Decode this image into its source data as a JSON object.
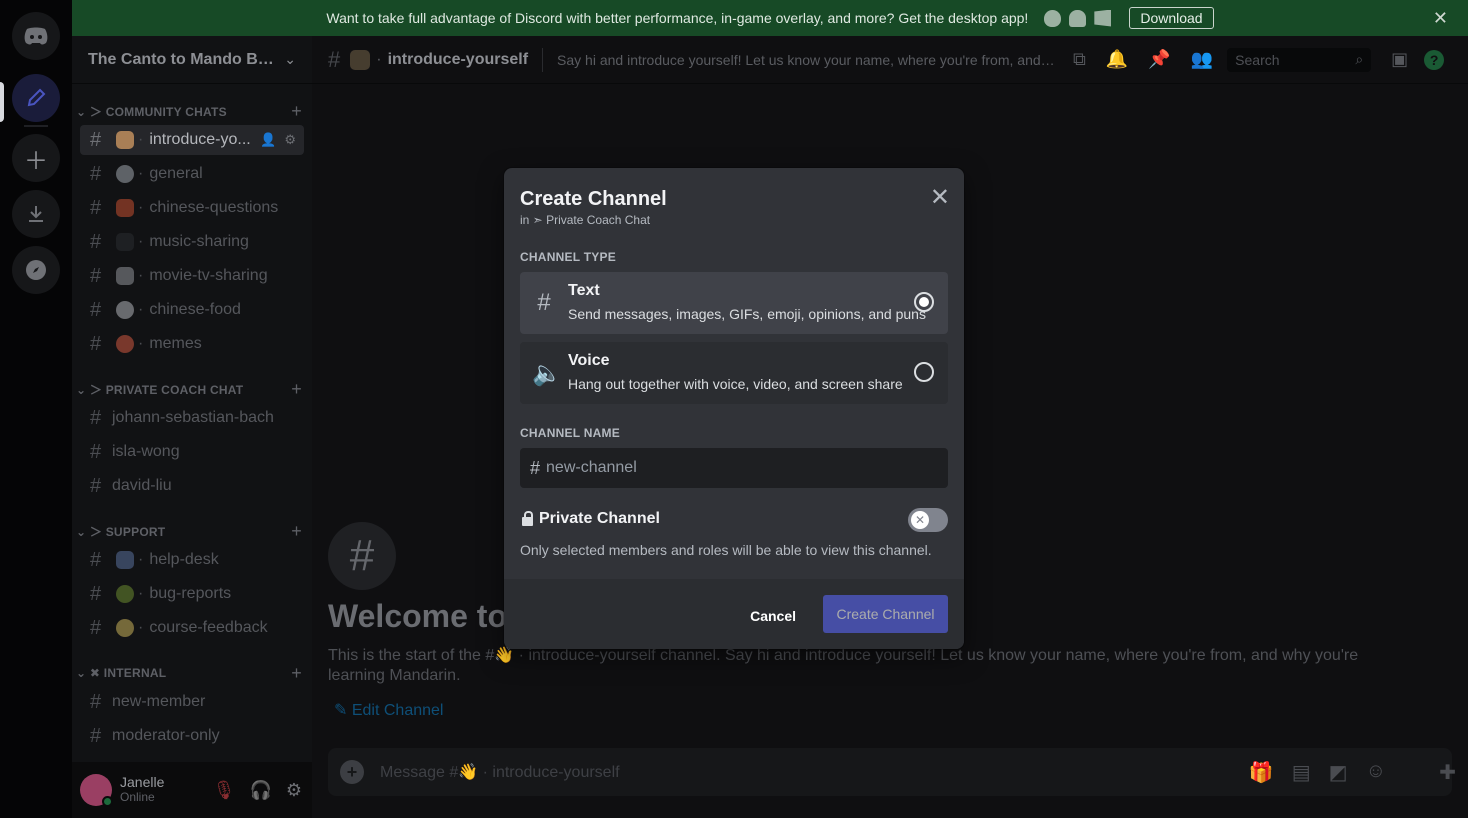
{
  "banner": {
    "text": "Want to take full advantage of Discord with better performance, in-game overlay, and more? Get the desktop app!",
    "download_label": "Download",
    "close_glyph": "✕",
    "platform_icons": [
      "apple-icon",
      "android-icon",
      "windows-icon"
    ]
  },
  "server_rail": {
    "items": [
      "discord-home-icon",
      "server-quill-icon",
      "add-server-icon",
      "download-apps-icon",
      "explore-icon"
    ]
  },
  "sidebar": {
    "guild_name": "The Canto to Mando Blu...",
    "categories": [
      {
        "name": "COMMUNITY CHATS",
        "channels": [
          {
            "name": "introduce-yo...",
            "emoji": "waving-hand",
            "active": true
          },
          {
            "name": "general",
            "emoji": "speech-bubble"
          },
          {
            "name": "chinese-questions",
            "emoji": "mahjong"
          },
          {
            "name": "music-sharing",
            "emoji": "music-notes"
          },
          {
            "name": "movie-tv-sharing",
            "emoji": "clapper"
          },
          {
            "name": "chinese-food",
            "emoji": "bowl"
          },
          {
            "name": "memes",
            "emoji": "clown"
          }
        ]
      },
      {
        "name": "PRIVATE COACH CHAT",
        "channels": [
          {
            "name": "johann-sebastian-bach"
          },
          {
            "name": "isla-wong"
          },
          {
            "name": "david-liu"
          }
        ]
      },
      {
        "name": "SUPPORT",
        "channels": [
          {
            "name": "help-desk",
            "emoji": "books"
          },
          {
            "name": "bug-reports",
            "emoji": "bug"
          },
          {
            "name": "course-feedback",
            "emoji": "lightbulb"
          }
        ]
      },
      {
        "name": "INTERNAL",
        "channels": [
          {
            "name": "new-member"
          },
          {
            "name": "moderator-only"
          }
        ]
      }
    ],
    "user": {
      "name": "Janelle",
      "status": "Online"
    }
  },
  "main": {
    "channel_name": "introduce-yourself",
    "topic": "Say hi and introduce yourself! Let us know your name, where you're from, and why...",
    "search_placeholder": "Search",
    "welcome_title": "Welcome to #",
    "welcome_desc": "This is the start of the #👋 · introduce-yourself channel. Say hi and introduce yourself! Let us know your name, where you're from, and why you're learning Mandarin.",
    "edit_channel": "Edit Channel",
    "message_placeholder": "Message #👋 · introduce-yourself"
  },
  "modal": {
    "title": "Create Channel",
    "subtitle": "in ➣ Private Coach Chat",
    "channel_type_label": "CHANNEL TYPE",
    "options": [
      {
        "name": "Text",
        "desc": "Send messages, images, GIFs, emoji, opinions, and puns",
        "selected": true
      },
      {
        "name": "Voice",
        "desc": "Hang out together with voice, video, and screen share",
        "selected": false
      }
    ],
    "channel_name_label": "CHANNEL NAME",
    "channel_name_placeholder": "new-channel",
    "private_label": "Private Channel",
    "private_desc": "Only selected members and roles will be able to view this channel.",
    "private_enabled": false,
    "cancel_label": "Cancel",
    "create_label": "Create Channel"
  },
  "colors": {
    "accent": "#5865f2",
    "banner": "#174a26",
    "modal_bg": "#313338"
  }
}
